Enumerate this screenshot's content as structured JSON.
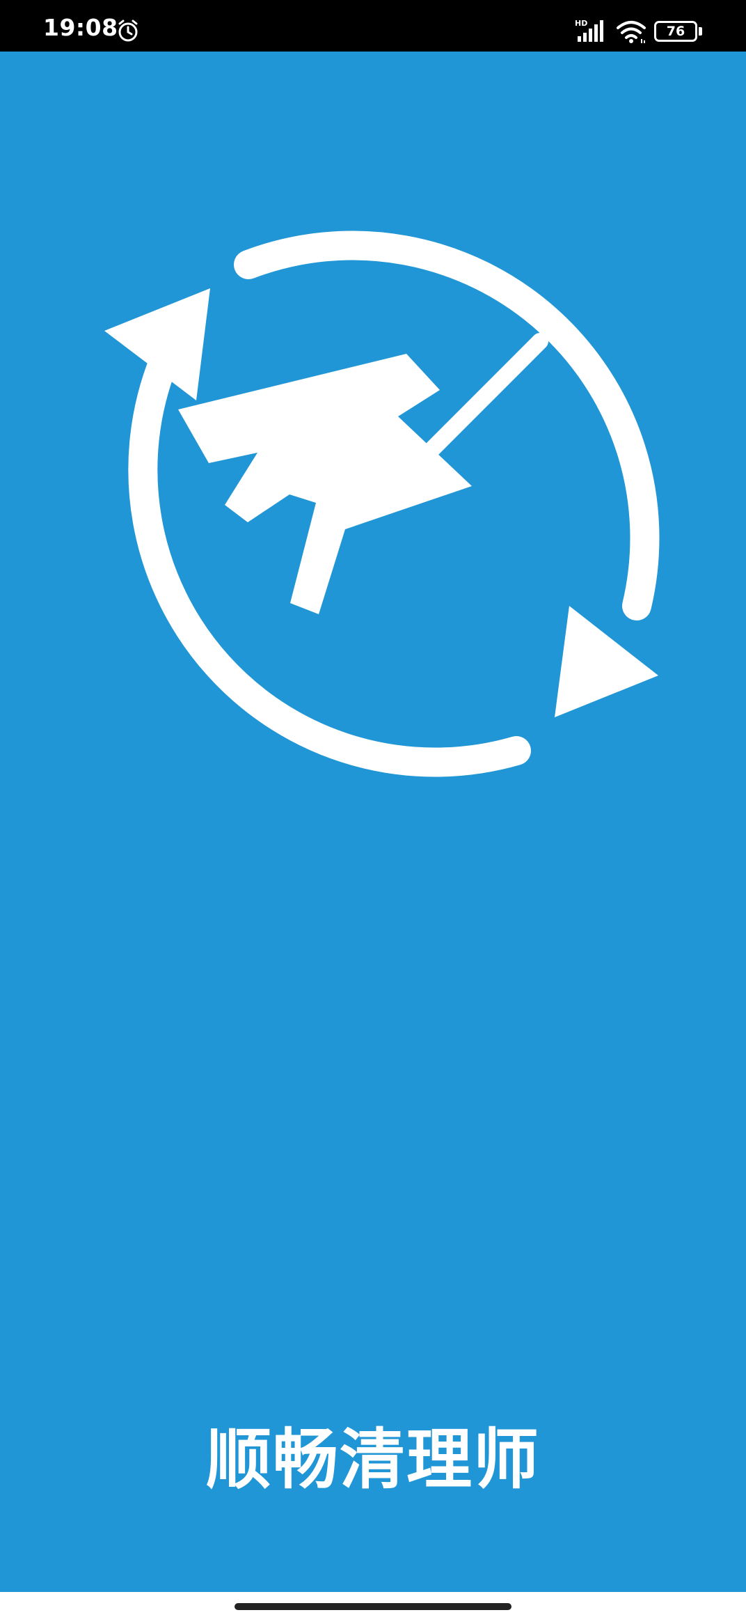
{
  "status_bar": {
    "time": "19:08",
    "network_label": "HD",
    "battery_level": "76",
    "icons": [
      "alarm-icon",
      "signal-icon",
      "wifi-icon",
      "battery-icon"
    ]
  },
  "splash": {
    "app_name": "顺畅清理师",
    "logo_icon": "broom-refresh-icon"
  },
  "colors": {
    "background": "#2196d6",
    "foreground": "#ffffff",
    "status_bar": "#000000"
  }
}
